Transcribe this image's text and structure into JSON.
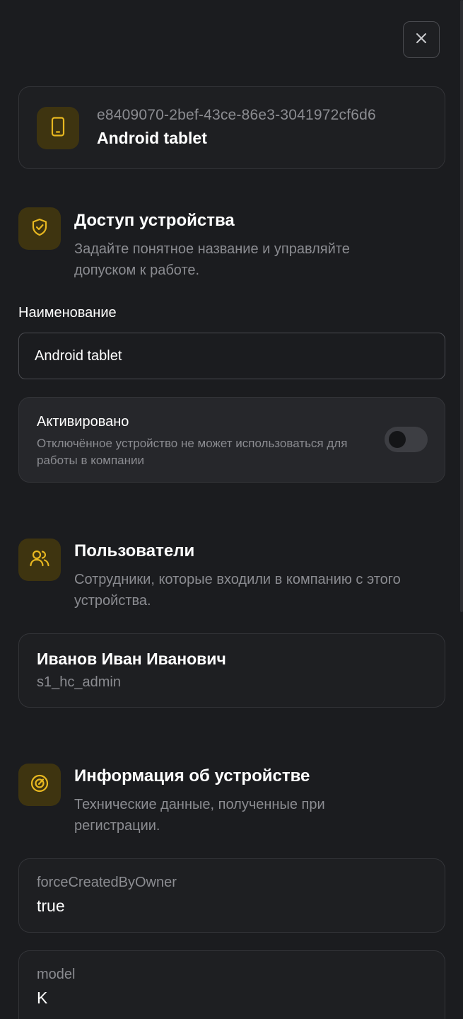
{
  "header": {
    "close_icon": "close-icon"
  },
  "device": {
    "id": "e8409070-2bef-43ce-86e3-3041972cf6d6",
    "name": "Android tablet",
    "icon": "tablet-icon"
  },
  "access": {
    "icon": "shield-check-icon",
    "title": "Доступ устройства",
    "description": "Задайте понятное название и управляйте допуском к работе.",
    "name_label": "Наименование",
    "name_value": "Android tablet",
    "toggle_title": "Активировано",
    "toggle_description": "Отключённое устройство не может использоваться для работы в компании",
    "toggle_on": false
  },
  "users": {
    "icon": "users-icon",
    "title": "Пользователи",
    "description": "Сотрудники, которые входили в компанию с этого устройства.",
    "items": [
      {
        "name": "Иванов Иван Иванович",
        "login": "s1_hc_admin"
      }
    ]
  },
  "info": {
    "icon": "gauge-icon",
    "title": "Информация об устройстве",
    "description": "Технические данные, полученные при регистрации.",
    "items": [
      {
        "key": "forceCreatedByOwner",
        "value": "true"
      },
      {
        "key": "model",
        "value": "K"
      }
    ]
  },
  "colors": {
    "background": "#1b1c1f",
    "card": "#1e1f22",
    "accent": "#e8b820",
    "accent_bg": "#3e3410",
    "muted_text": "#8b8c91"
  }
}
